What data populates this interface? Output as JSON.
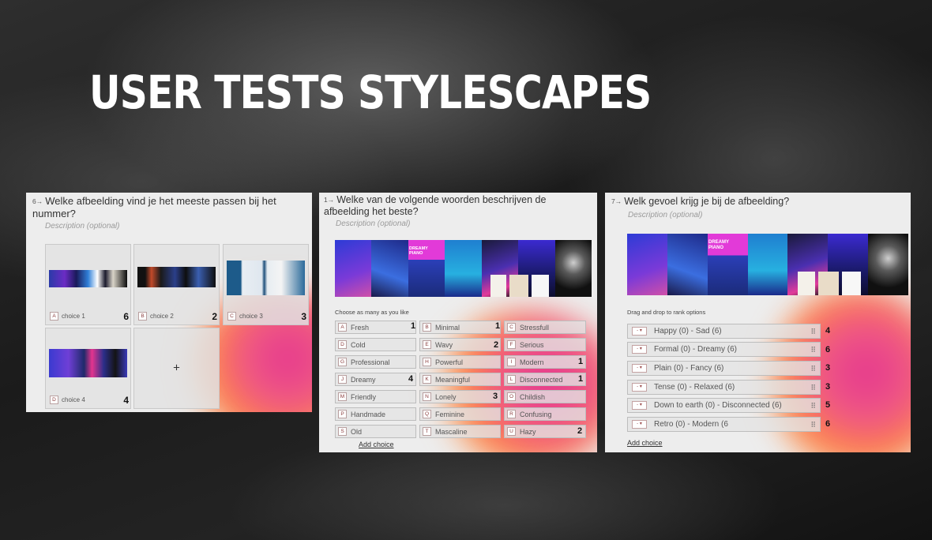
{
  "page_title": "USER TESTS STYLESCAPES",
  "colors": {
    "accent_pink": "#e4358f",
    "accent_orange": "#ff8a3d",
    "key_border": "#b9a0a0"
  },
  "panel1": {
    "number": "6→",
    "question": "Welke afbeelding vind je het meeste passen bij het nummer?",
    "description": "Description (optional)",
    "tiles": [
      {
        "key": "A",
        "label": "choice 1",
        "count": "6"
      },
      {
        "key": "B",
        "label": "choice 2",
        "count": "2"
      },
      {
        "key": "C",
        "label": "choice 3",
        "count": "3"
      },
      {
        "key": "D",
        "label": "choice 4",
        "count": "4"
      }
    ],
    "add_symbol": "+"
  },
  "panel2": {
    "number": "1→",
    "question": "Welke van de volgende woorden beschrijven de afbeelding het beste?",
    "description": "Description (optional)",
    "banner_text": "DREAMY PIANO",
    "hint": "Choose as many as you like",
    "choices": [
      {
        "key": "A",
        "label": "Fresh",
        "count": "1"
      },
      {
        "key": "B",
        "label": "Minimal",
        "count": "1"
      },
      {
        "key": "C",
        "label": "Stressfull",
        "count": ""
      },
      {
        "key": "D",
        "label": "Cold",
        "count": ""
      },
      {
        "key": "E",
        "label": "Wavy",
        "count": "2"
      },
      {
        "key": "F",
        "label": "Serious",
        "count": ""
      },
      {
        "key": "G",
        "label": "Professional",
        "count": ""
      },
      {
        "key": "H",
        "label": "Powerful",
        "count": ""
      },
      {
        "key": "I",
        "label": "Modern",
        "count": "1"
      },
      {
        "key": "J",
        "label": "Dreamy",
        "count": "4"
      },
      {
        "key": "K",
        "label": "Meaningful",
        "count": ""
      },
      {
        "key": "L",
        "label": "Disconnected",
        "count": "1"
      },
      {
        "key": "M",
        "label": "Friendly",
        "count": ""
      },
      {
        "key": "N",
        "label": "Lonely",
        "count": "3"
      },
      {
        "key": "O",
        "label": "Childish",
        "count": ""
      },
      {
        "key": "P",
        "label": "Handmade",
        "count": ""
      },
      {
        "key": "Q",
        "label": "Feminine",
        "count": ""
      },
      {
        "key": "R",
        "label": "Confusing",
        "count": ""
      },
      {
        "key": "S",
        "label": "Old",
        "count": ""
      },
      {
        "key": "T",
        "label": "Mascaline",
        "count": ""
      },
      {
        "key": "U",
        "label": "Hazy",
        "count": "2"
      }
    ],
    "add_choice": "Add choice"
  },
  "panel3": {
    "number": "7→",
    "question": "Welk gevoel krijg je bij de afbeelding?",
    "description": "Description (optional)",
    "banner_text": "DREAMY PIANO",
    "hint": "Drag and drop to rank options",
    "select_marker": "- ▾",
    "grip": "⠿",
    "options": [
      {
        "label": "Happy (0) - Sad (6)",
        "count": "4"
      },
      {
        "label": "Formal (0) - Dreamy (6)",
        "count": "6"
      },
      {
        "label": "Plain (0) - Fancy (6)",
        "count": "3"
      },
      {
        "label": "Tense (0) - Relaxed (6)",
        "count": "3"
      },
      {
        "label": "Down to earth (0) - Disconnected (6)",
        "count": "5"
      },
      {
        "label": "Retro (0) - Modern (6",
        "count": "6"
      }
    ],
    "add_choice": "Add choice"
  }
}
